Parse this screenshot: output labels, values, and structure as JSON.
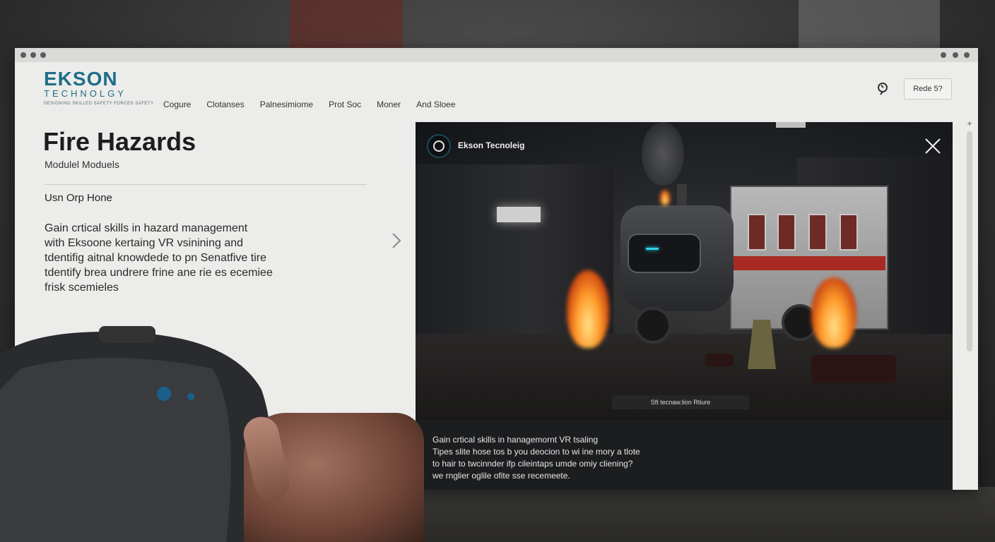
{
  "window": {
    "logo": {
      "main": "EKSON",
      "sub": "TECHNOLGY",
      "tagline": "DESIGNING SKILLED SAFETY FORCES SAFETY"
    },
    "nav": [
      "Cogure",
      "Clotanses",
      "Palnesimiome",
      "Prot Soc",
      "Moner",
      "And Sloee"
    ],
    "header_button": "Rede 5?",
    "title": "Fire Hazards",
    "modules": "Modulel Moduels",
    "subheading": "Usn Orp Hone",
    "description": [
      "Gain crtical skills in hazard management",
      "with Eksoone kertaing VR vsinining and",
      "tdentifig aitnal knowdede to pn Senatfive tire",
      "tdentify brea undrere frine ane rie es ecemiee",
      "frisk scemieles"
    ]
  },
  "video": {
    "brand": "Ekson Tecnoleig",
    "caption": "Sft tecnaw.lion Rtiure",
    "panel_lines": [
      "Gain crtical skills in hanagemornt VR tsaling",
      "Tipes slite hose tos b you deocion to wi ine mory a tlote",
      "to hair to twcinnder ifp cileintaps umde omiy cliening?",
      "we rnglier oglile ofite sse recemeete."
    ]
  },
  "colors": {
    "brand": "#1d6e8a",
    "window_bg": "#ececea",
    "panel_bg": "#1c1d1f",
    "visor_led": "#2fd4e8"
  },
  "icons": [
    "location-pin-icon",
    "chevron-right-icon",
    "close-icon",
    "plus-icon"
  ]
}
